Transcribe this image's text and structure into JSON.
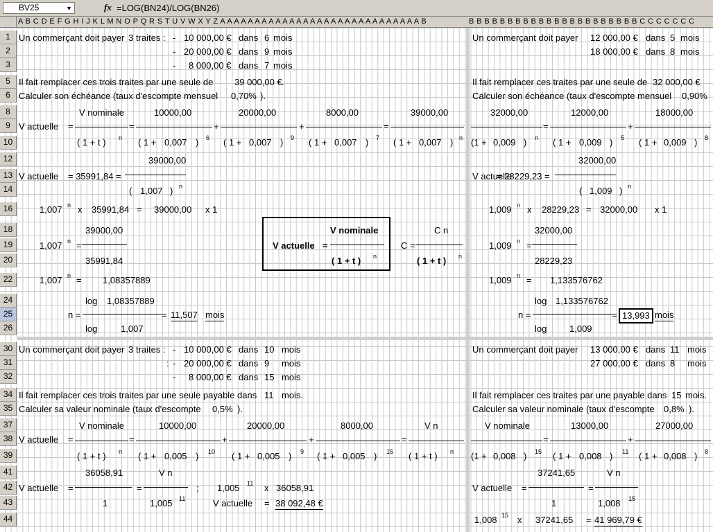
{
  "formula_bar": {
    "cell_ref": "BV25",
    "fx": "fx",
    "formula": "=LOG(BN24)/LOG(BN26)"
  },
  "columns_left": "A B C D E F G H I J K L M N O P Q R S T U V W X Y Z A A A A A A A A A A A A A A A A A A A A A A A A A A A A A B",
  "columns_right": "B B B B B B B B B B B B B B B B B B B B B B C C C C C C C",
  "rows": [
    "1",
    "2",
    "3",
    "5",
    "6",
    "8",
    "9",
    "10",
    "12",
    "13",
    "14",
    "16",
    "18",
    "19",
    "20",
    "22",
    "24",
    "25",
    "26",
    "30",
    "31",
    "32",
    "34",
    "35",
    "37",
    "38",
    "39",
    "41",
    "42",
    "43",
    "44"
  ],
  "left": {
    "r1": {
      "a": "Un commerçant doit payer",
      "b": "3",
      "c": "traites :",
      "d": "-",
      "e": "10 000,00 €",
      "f": "dans",
      "g": "6",
      "h": "mois"
    },
    "r2": {
      "d": "-",
      "e": "20 000,00 €",
      "f": "dans",
      "g": "9",
      "h": "mois"
    },
    "r3": {
      "d": "-",
      "e": "8 000,00 €",
      "f": "dans",
      "g": "7",
      "h": "mois"
    },
    "r5": {
      "a": "Il fait remplacer ces trois traites par une seule de",
      "b": "39 000,00 €",
      "c": "."
    },
    "r6": {
      "a": "Calculer son échéance (taux d'escompte mensuel",
      "b": "0,70%",
      "c": ")."
    },
    "r8": {
      "a": "V nominale",
      "b": "10000,00",
      "c": "20000,00",
      "d": "8000,00",
      "e": "39000,00"
    },
    "r9": {
      "a": "V actuelle",
      "eq1": "=",
      "eq2": "=",
      "plus1": "+",
      "plus2": "+",
      "eq3": "="
    },
    "r10": {
      "a": "( 1 + t )",
      "an": "n",
      "b": "( 1 +",
      "b2": "0,007",
      "b3": ")",
      "bn": "6",
      "c": "( 1 +",
      "c2": "0,007",
      "c3": ")",
      "cn": "9",
      "d": "( 1 +",
      "d2": "0,007",
      "d3": ")",
      "dn": "7",
      "e": "( 1 +",
      "e2": "0,007",
      "e3": ")",
      "en": "n"
    },
    "r12": {
      "a": "39000,00"
    },
    "r13": {
      "a": "V actuelle",
      "b": "= 35991,84 ="
    },
    "r14": {
      "a": "(",
      "b": "1,007",
      "c": ")",
      "n": "n"
    },
    "r16": {
      "a": "1,007",
      "n": "n",
      "x": "x",
      "b": "35991,84",
      "eq": "=",
      "c": "39000,00",
      "d": "x 1"
    },
    "r18": {
      "a": "39000,00"
    },
    "r19": {
      "a": "1,007",
      "n": "n",
      "eq": "="
    },
    "r20": {
      "a": "35991,84"
    },
    "r22": {
      "a": "1,007",
      "n": "n",
      "eq": "=",
      "b": "1,08357889"
    },
    "r24": {
      "a": "log",
      "b": "1,08357889"
    },
    "r25": {
      "a": "n =",
      "eq": "=",
      "b": "11,507",
      "c": "mois"
    },
    "r26": {
      "a": "log",
      "b": "1,007"
    },
    "r30": {
      "a": "Un commerçant doit payer",
      "b": "3",
      "c": "traites :",
      "d": "-",
      "e": "10 000,00 €",
      "f": "dans",
      "g": "10",
      "h": "mois"
    },
    "r31": {
      "c": ":",
      "d": "-",
      "e": "20 000,00 €",
      "f": "dans",
      "g": "9",
      "h": "mois"
    },
    "r32": {
      "d": "-",
      "e": "8 000,00 €",
      "f": "dans",
      "g": "15",
      "h": "mois"
    },
    "r34": {
      "a": "Il fait remplacer ces trois traites par une seule payable dans",
      "b": "11",
      "c": "mois."
    },
    "r35": {
      "a": "Calculer sa valeur nominale (taux d'escompte",
      "b": "0,5%",
      "c": ")."
    },
    "r37": {
      "a": "V nominale",
      "b": "10000,00",
      "c": "20000,00",
      "d": "8000,00",
      "e": "V n"
    },
    "r38": {
      "a": "V actuelle",
      "eq1": "=",
      "eq2": "=",
      "plus1": "+",
      "plus2": "+",
      "eq3": "="
    },
    "r39": {
      "a": "( 1 + t )",
      "an": "n",
      "b": "( 1 +",
      "b2": "0,005",
      "b3": ")",
      "bn": "10",
      "c": "( 1 +",
      "c2": "0,005",
      "c3": ")",
      "cn": "9",
      "d": "( 1 +",
      "d2": "0,005",
      "d3": ")",
      "dn": "15",
      "e": "( 1 + t )",
      "en": "n"
    },
    "r41": {
      "a": "36058,91",
      "b": "V n"
    },
    "r42": {
      "a": "V actuelle",
      "eq1": "=",
      "eq2": "=",
      "semi": ";",
      "b": "1,005",
      "bn": "11",
      "x": "x",
      "c": "36058,91"
    },
    "r43": {
      "a": "1",
      "b": "1,005",
      "bn": "11",
      "c": "V actuelle",
      "eq": "=",
      "d": "38 092,48 €"
    }
  },
  "center_box": {
    "label": "V actuelle",
    "eq": "=",
    "num": "V nominale",
    "den": "( 1 + t )",
    "n": "n",
    "c_eq": "C =",
    "c_num": "C n",
    "c_den": "( 1 + t )",
    "c_n": "n"
  },
  "right": {
    "r1": {
      "a": "Un commerçant doit payer",
      "b": "12 000,00 €",
      "c": "dans",
      "d": "5",
      "e": "mois"
    },
    "r2": {
      "b": "18 000,00 €",
      "c": "dans",
      "d": "8",
      "e": "mois"
    },
    "r5": {
      "a": "Il fait remplacer ces traites par une seule de",
      "b": "32 000,00 €"
    },
    "r6": {
      "a": "Calculer son échéance (taux d'escompte mensuel",
      "b": "0,90%"
    },
    "r8": {
      "a": "32000,00",
      "b": "12000,00",
      "c": "18000,00"
    },
    "r9": {
      "eq": "=",
      "plus": "+"
    },
    "r10": {
      "a": "(1 +",
      "a2": "0,009",
      "a3": ")",
      "an": "n",
      "b": "( 1 +",
      "b2": "0,009",
      "b3": ")",
      "bn": "5",
      "c": "( 1 +",
      "c2": "0,009",
      "c3": ")",
      "cn": "8"
    },
    "r12": {
      "a": "32000,00"
    },
    "r13": {
      "a": "V actuelle",
      "b": "= 28229,23 ="
    },
    "r14": {
      "a": "(",
      "b": "1,009",
      "c": ")",
      "n": "n"
    },
    "r16": {
      "a": "1,009",
      "n": "n",
      "x": "x",
      "b": "28229,23",
      "eq": "=",
      "c": "32000,00",
      "d": "x 1"
    },
    "r18": {
      "a": "32000,00"
    },
    "r19": {
      "a": "1,009",
      "n": "n",
      "eq": "="
    },
    "r20": {
      "a": "28229,23"
    },
    "r22": {
      "a": "1,009",
      "n": "n",
      "eq": "=",
      "b": "1,133576762"
    },
    "r24": {
      "a": "log",
      "b": "1,133576762"
    },
    "r25": {
      "a": "n =",
      "eq": "=",
      "b": "13,993",
      "c": "mois"
    },
    "r26": {
      "a": "log",
      "b": "1,009"
    },
    "r30": {
      "a": "Un commerçant doit payer",
      "b": "13 000,00 €",
      "c": "dans",
      "d": "11",
      "e": "mois"
    },
    "r31": {
      "b": "27 000,00 €",
      "c": "dans",
      "d": "8",
      "e": "mois"
    },
    "r34": {
      "a": "Il fait remplacer ces traites par une payable dans",
      "b": "15",
      "c": "mois."
    },
    "r35": {
      "a": "Calculer sa valeur nominale (taux d'escompte",
      "b": "0,8%",
      "c": ")."
    },
    "r37": {
      "a": "V nominale",
      "b": "13000,00",
      "c": "27000,00"
    },
    "r38": {
      "eq": "=",
      "plus": "+"
    },
    "r39": {
      "a": "(1 +",
      "a2": "0,008",
      "a3": ")",
      "an": "15",
      "b": "( 1 +",
      "b2": "0,008",
      "b3": ")",
      "bn": "11",
      "c": "( 1 +",
      "c2": "0,008",
      "c3": ")",
      "cn": "8"
    },
    "r41": {
      "a": "37241,65",
      "b": "V n"
    },
    "r42": {
      "a": "V actuelle",
      "eq1": "=",
      "eq2": "="
    },
    "r43": {
      "a": "1",
      "b": "1,008",
      "bn": "15"
    },
    "r44": {
      "a": "1,008",
      "an": "15",
      "x": "x",
      "b": "37241,65",
      "eq": "=",
      "c": "41 969,79 €"
    }
  }
}
